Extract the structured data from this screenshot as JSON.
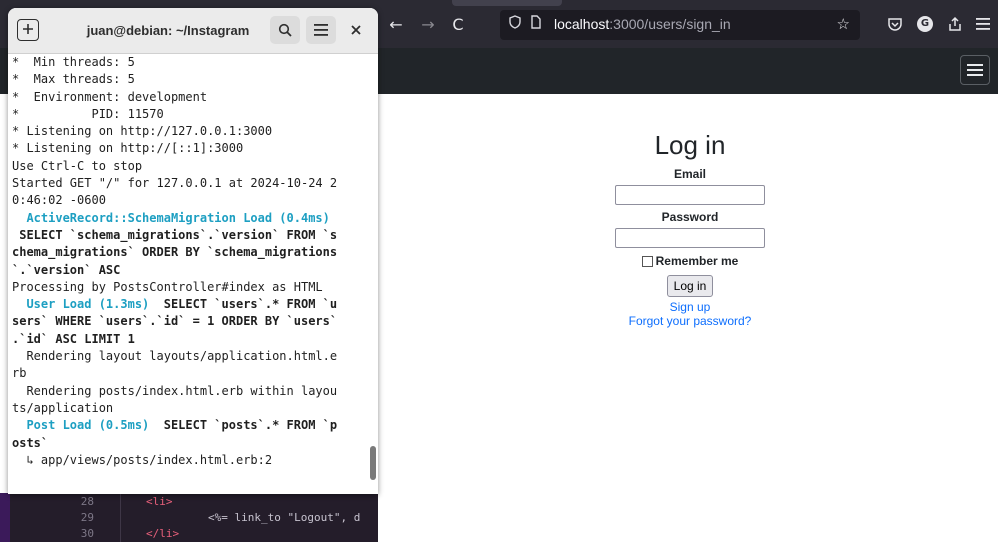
{
  "browser": {
    "toolbar": {
      "back": "←",
      "forward": "→",
      "reload": "C",
      "url_host": "localhost",
      "url_path": ":3000/users/sign_in",
      "bookmark_star": "☆"
    },
    "login": {
      "title": "Log in",
      "email_label": "Email",
      "password_label": "Password",
      "remember_label": "Remember me",
      "submit_label": "Log in",
      "signup_link": "Sign up",
      "forgot_link": "Forgot your password?"
    }
  },
  "terminal": {
    "title": "juan@debian: ~/Instagram",
    "lines": [
      {
        "text": "*  Min threads: 5",
        "style": ""
      },
      {
        "text": "*  Max threads: 5",
        "style": ""
      },
      {
        "text": "*  Environment: development",
        "style": ""
      },
      {
        "text": "*          PID: 11570",
        "style": ""
      },
      {
        "text": "* Listening on http://127.0.0.1:3000",
        "style": ""
      },
      {
        "text": "* Listening on http://[::1]:3000",
        "style": ""
      },
      {
        "text": "Use Ctrl-C to stop",
        "style": ""
      },
      {
        "text": "Started GET \"/\" for 127.0.0.1 at 2024-10-24 2",
        "style": ""
      },
      {
        "text": "0:46:02 -0600",
        "style": ""
      },
      {
        "text": "  ActiveRecord::SchemaMigration Load (0.4ms)",
        "style": "cyan"
      },
      {
        "text": " SELECT `schema_migrations`.`version` FROM `s",
        "style": "bold"
      },
      {
        "text": "chema_migrations` ORDER BY `schema_migrations",
        "style": "bold"
      },
      {
        "text": "`.`version` ASC",
        "style": "bold"
      },
      {
        "text": "Processing by PostsController#index as HTML",
        "style": ""
      },
      {
        "segments": [
          {
            "text": "  User Load (1.3ms)  ",
            "style": "cyan"
          },
          {
            "text": "SELECT `users`.* FROM `u",
            "style": "bold"
          }
        ]
      },
      {
        "text": "sers` WHERE `users`.`id` = 1 ORDER BY `users`",
        "style": "bold"
      },
      {
        "text": ".`id` ASC LIMIT 1",
        "style": "bold"
      },
      {
        "text": "  Rendering layout layouts/application.html.e",
        "style": ""
      },
      {
        "text": "rb",
        "style": ""
      },
      {
        "text": "  Rendering posts/index.html.erb within layou",
        "style": ""
      },
      {
        "text": "ts/application",
        "style": ""
      },
      {
        "segments": [
          {
            "text": "  Post Load (0.5ms)  ",
            "style": "cyan"
          },
          {
            "text": "SELECT `posts`.* FROM `p",
            "style": "bold"
          }
        ]
      },
      {
        "text": "osts`",
        "style": "bold"
      },
      {
        "text": "  ↳ app/views/posts/index.html.erb:2",
        "style": ""
      }
    ]
  },
  "editor": {
    "lines": [
      {
        "num": "28",
        "code": "<li>",
        "code2": ""
      },
      {
        "num": "29",
        "code": "",
        "code2": "<%= link_to \"Logout\", d"
      },
      {
        "num": "30",
        "code": "</li>",
        "code2": ""
      }
    ]
  },
  "colors": {
    "browser_toolbar": "#2b2a33",
    "site_navbar": "#212529",
    "link": "#0d6efd",
    "terminal_cyan": "#1d9fc2",
    "editor_bg": "#241d2a"
  },
  "icons": {
    "tracking_shield": "shield-icon",
    "page_info": "page-icon",
    "pocket": "pocket-icon",
    "extension": "extension-g-icon",
    "share": "share-icon",
    "menu": "menu-icon"
  }
}
